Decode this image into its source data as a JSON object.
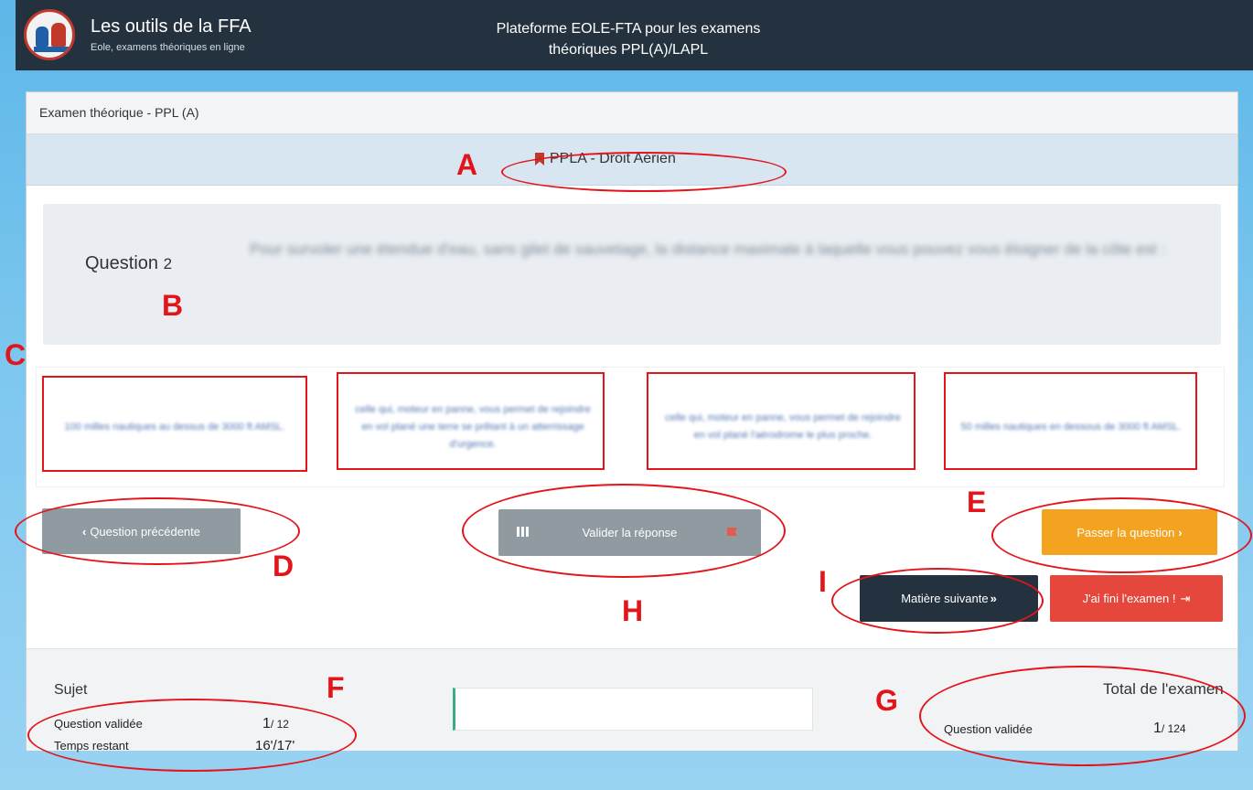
{
  "header": {
    "app_title": "Les outils de la FFA",
    "app_subtitle": "Eole, examens théoriques en ligne",
    "platform_line1": "Plateforme EOLE-FTA pour les examens",
    "platform_line2": "théoriques PPL(A)/LAPL"
  },
  "card": {
    "title": "Examen théorique - PPL (A)",
    "subject": "PPLA - Droit Aérien"
  },
  "question": {
    "label": "Question",
    "number": "2",
    "text": "Pour survoler une étendue d'eau, sans gilet de sauvetage, la distance maximale à laquelle vous pouvez vous éloigner de la côte est :"
  },
  "answers": [
    "100 milles nautiques au dessus de 3000 ft AMSL.",
    "celle qui, moteur en panne, vous permet de rejoindre en vol plané une terre se prêtant à un atterrissage d'urgence.",
    "celle qui, moteur en panne, vous permet de rejoindre en vol plané l'aérodrome le plus proche.",
    "50 milles nautiques en dessous de 3000 ft AMSL."
  ],
  "buttons": {
    "prev": "Question précédente",
    "validate": "Valider la réponse",
    "skip": "Passer la question",
    "next_subject": "Matière suivante",
    "finish": "J'ai fini l'examen !"
  },
  "footer": {
    "sujet_label": "Sujet",
    "validated_label": "Question validée",
    "validated_value": "1",
    "validated_total": "/ 12",
    "time_label": "Temps restant",
    "time_value": "16'/17'",
    "total_label": "Total de l'examen",
    "total_validated_label": "Question validée",
    "total_validated_value": "1",
    "total_validated_total": "/ 124"
  },
  "annotations": {
    "A": "A",
    "B": "B",
    "C": "C",
    "D": "D",
    "E": "E",
    "F": "F",
    "G": "G",
    "H": "H",
    "I": "I"
  },
  "colors": {
    "accent_annotation": "#e4141b",
    "skip": "#f3a31f",
    "finish": "#e5473c",
    "next_subject": "#243240",
    "neutral_button": "#8f9aa1"
  }
}
